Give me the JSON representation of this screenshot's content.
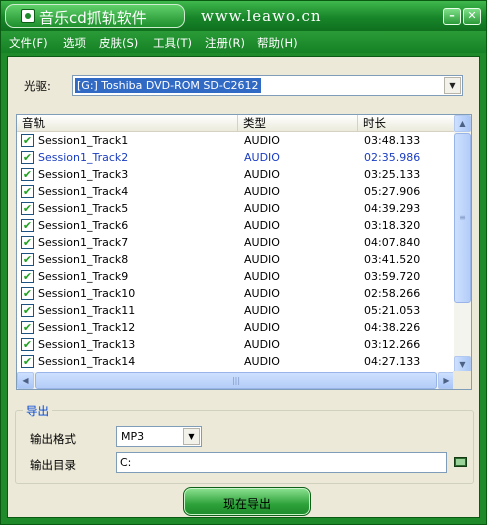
{
  "window": {
    "app_title": "音乐cd抓轨软件",
    "site_url": "www.leawo.cn",
    "minimize_glyph": "–",
    "close_glyph": "✕"
  },
  "menu": [
    {
      "label": "文件(F)"
    },
    {
      "label": "选项"
    },
    {
      "label": "皮肤(S)"
    },
    {
      "label": "工具(T)"
    },
    {
      "label": "注册(R)"
    },
    {
      "label": "帮助(H)"
    }
  ],
  "drive": {
    "label": "光驱:",
    "value": "[G:] Toshiba  DVD-ROM SD-C2612"
  },
  "tracklist": {
    "columns": [
      "音轨",
      "类型",
      "时长"
    ],
    "rows": [
      {
        "name": "Session1_Track1",
        "type": "AUDIO",
        "duration": "03:48.133",
        "checked": true
      },
      {
        "name": "Session1_Track2",
        "type": "AUDIO",
        "duration": "02:35.986",
        "checked": true,
        "selected": true
      },
      {
        "name": "Session1_Track3",
        "type": "AUDIO",
        "duration": "03:25.133",
        "checked": true
      },
      {
        "name": "Session1_Track4",
        "type": "AUDIO",
        "duration": "05:27.906",
        "checked": true
      },
      {
        "name": "Session1_Track5",
        "type": "AUDIO",
        "duration": "04:39.293",
        "checked": true
      },
      {
        "name": "Session1_Track6",
        "type": "AUDIO",
        "duration": "03:18.320",
        "checked": true
      },
      {
        "name": "Session1_Track7",
        "type": "AUDIO",
        "duration": "04:07.840",
        "checked": true
      },
      {
        "name": "Session1_Track8",
        "type": "AUDIO",
        "duration": "03:41.520",
        "checked": true
      },
      {
        "name": "Session1_Track9",
        "type": "AUDIO",
        "duration": "03:59.720",
        "checked": true
      },
      {
        "name": "Session1_Track10",
        "type": "AUDIO",
        "duration": "02:58.266",
        "checked": true
      },
      {
        "name": "Session1_Track11",
        "type": "AUDIO",
        "duration": "05:21.053",
        "checked": true
      },
      {
        "name": "Session1_Track12",
        "type": "AUDIO",
        "duration": "04:38.226",
        "checked": true
      },
      {
        "name": "Session1_Track13",
        "type": "AUDIO",
        "duration": "03:12.266",
        "checked": true
      },
      {
        "name": "Session1_Track14",
        "type": "AUDIO",
        "duration": "04:27.133",
        "checked": true
      }
    ]
  },
  "export": {
    "group_title": "导出",
    "format_label": "输出格式",
    "format_value": "MP3",
    "dir_label": "输出目录",
    "dir_value": "C:",
    "button_label": "现在导出"
  },
  "icons": {
    "app": "music-cd-icon",
    "folder": "folder-browse-icon",
    "check": "✔",
    "arrow_down": "▼",
    "arrow_up": "▲",
    "arrow_left": "◀",
    "arrow_right": "▶"
  },
  "colors": {
    "theme_green": "#1e8a2a",
    "selection_blue": "#316ac5",
    "group_title_blue": "#0046d5"
  }
}
